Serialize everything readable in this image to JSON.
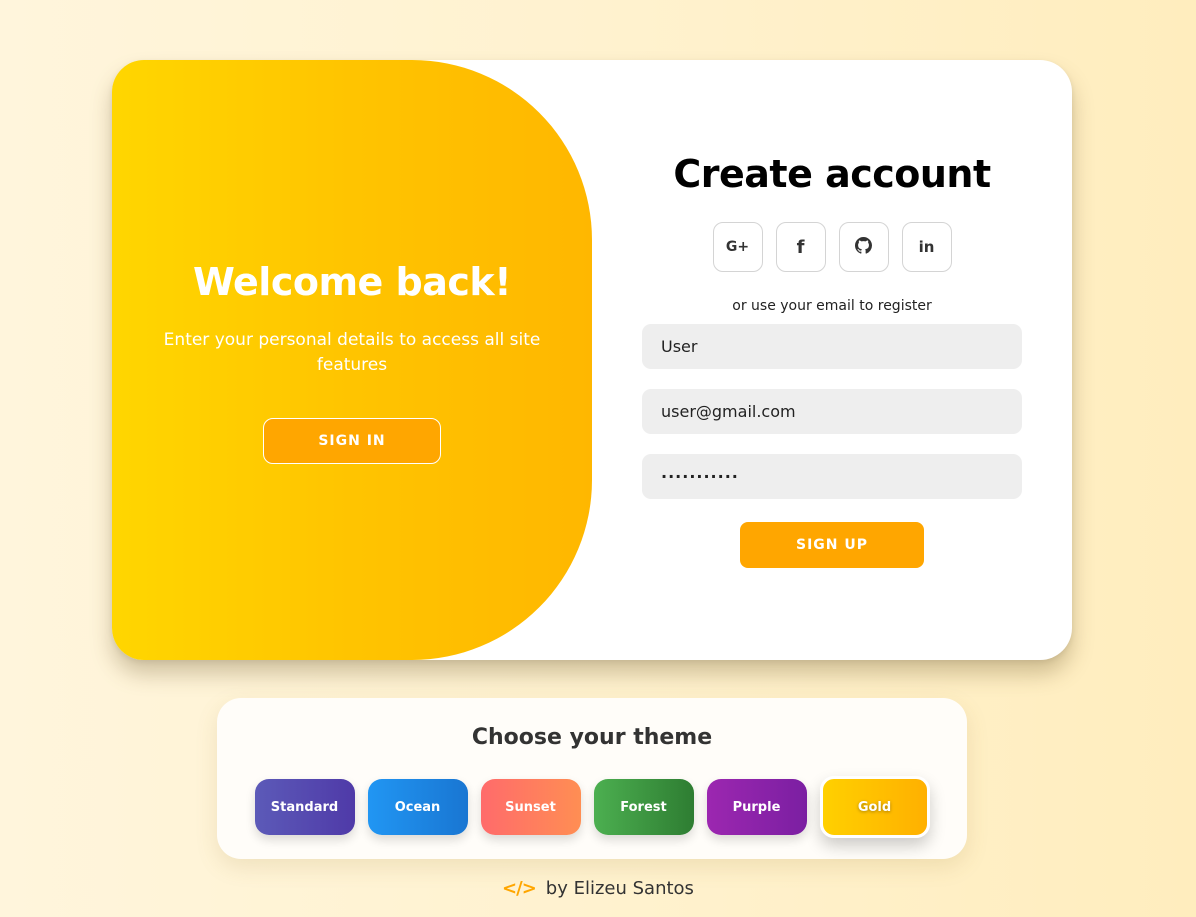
{
  "welcome": {
    "title": "Welcome back!",
    "text": "Enter your personal details to access all site features",
    "signin_label": "SIGN IN"
  },
  "register": {
    "title": "Create account",
    "socials": [
      {
        "name": "google-plus-icon",
        "glyph": "G+"
      },
      {
        "name": "facebook-icon",
        "glyph": "f"
      },
      {
        "name": "github-icon",
        "glyph": ""
      },
      {
        "name": "linkedin-icon",
        "glyph": "in"
      }
    ],
    "hint": "or use your email to register",
    "name_value": "User",
    "email_value": "user@gmail.com",
    "password_value": "···········",
    "signup_label": "SIGN UP"
  },
  "themes": {
    "title": "Choose your theme",
    "items": [
      {
        "label": "Standard",
        "from": "#5c5ab8",
        "to": "#4f3aa8"
      },
      {
        "label": "Ocean",
        "from": "#2196f3",
        "to": "#1976d2"
      },
      {
        "label": "Sunset",
        "from": "#ff6b6b",
        "to": "#ff8e53"
      },
      {
        "label": "Forest",
        "from": "#4caf50",
        "to": "#2e7d32"
      },
      {
        "label": "Purple",
        "from": "#9c27b0",
        "to": "#7b1fa2"
      },
      {
        "label": "Gold",
        "from": "#ffd000",
        "to": "#ffb000"
      }
    ],
    "selected": "Gold"
  },
  "credit": {
    "icon": "code-icon",
    "text": "by Elizeu Santos"
  },
  "colors": {
    "accent": "#ffa600",
    "background": "#fff2cf"
  }
}
